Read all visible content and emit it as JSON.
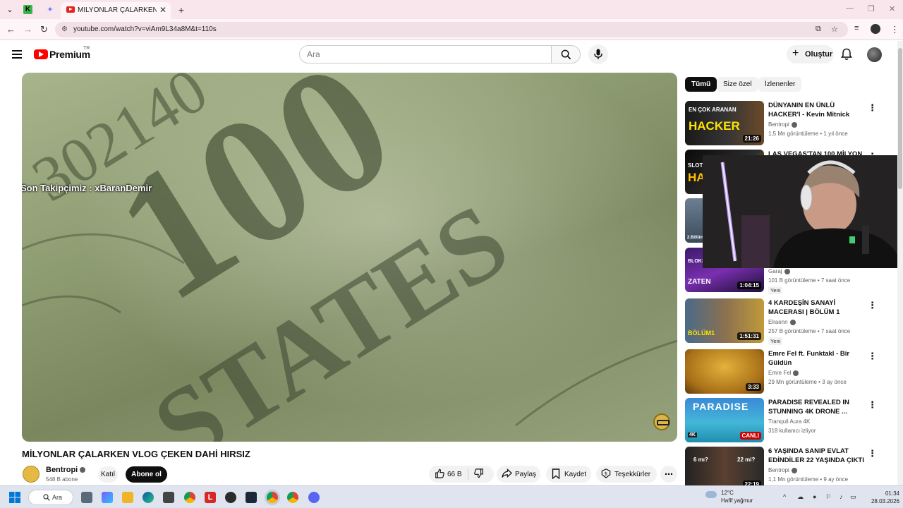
{
  "browser": {
    "tab_title": "MİLYONLAR ÇALARKEN VLOG ÇEKEN DAHİ HIRSIZ",
    "url": "youtube.com/watch?v=viAm9L34a8M&t=110s"
  },
  "masthead": {
    "logo_text": "Premium",
    "country_code": "TR",
    "search_placeholder": "Ara",
    "create_label": "Oluştur"
  },
  "player": {
    "overlay_text": "Son Takipçimiz : xBaranDemir"
  },
  "video": {
    "title": "MİLYONLAR ÇALARKEN VLOG ÇEKEN DAHİ HIRSIZ",
    "channel": "Bentropi",
    "subscribers": "548 B abone",
    "join_label": "Katıl",
    "subscribe_label": "Abone ol",
    "likes": "66 B",
    "share_label": "Paylaş",
    "save_label": "Kaydet",
    "thanks_label": "Teşekkürler"
  },
  "chips": [
    "Tümü",
    "Size özel",
    "İzlenenler"
  ],
  "recommendations": [
    {
      "title": "DÜNYANIN EN ÜNLÜ HACKER'I - Kevin Mitnick",
      "channel": "Bentropi",
      "meta": "1,5 Mn görüntüleme • 1 yıl önce",
      "duration": "21:26",
      "badge": ""
    },
    {
      "title": "LAS VEGAS'TAN 100 MİLYON",
      "channel": "",
      "meta": "",
      "duration": "",
      "badge": ""
    },
    {
      "title": "",
      "channel": "",
      "meta": "",
      "duration": "",
      "badge": ""
    },
    {
      "title": "",
      "channel": "Garaj",
      "meta": "101 B görüntüleme • 7 saat önce",
      "duration": "1:04:15",
      "badge": "Yeni"
    },
    {
      "title": "4 KARDEŞİN SANAYİ MACERASI | BÖLÜM 1",
      "channel": "Elraenn",
      "meta": "257 B görüntüleme • 7 saat önce",
      "duration": "1:51:31",
      "badge": "Yeni"
    },
    {
      "title": "Emre Fel ft. Funktakl - Bir Güldün",
      "channel": "Emre Fel",
      "meta": "29 Mn görüntüleme • 3 ay önce",
      "duration": "3:33",
      "badge": ""
    },
    {
      "title": "PARADISE REVEALED IN STUNNING 4K DRONE ...",
      "channel": "Tranquil Aura 4K",
      "meta": "318 kullanıcı izliyor",
      "duration": "CANLI",
      "badge": ""
    },
    {
      "title": "6 YAŞINDA SANIP EVLAT EDİNDİLER 22 YAŞINDA ÇIKTI",
      "channel": "Bentropi",
      "meta": "1,1 Mn görüntüleme • 9 ay önce",
      "duration": "22:19",
      "badge": ""
    }
  ],
  "thumb_labels": {
    "hacker_top": "EN ÇOK ARANAN",
    "hacker_main": "HACKER",
    "vegas_top": "SLOT",
    "vegas_main": "HA",
    "garaj_top": "BLOK3",
    "garaj_main": "ZATEN",
    "sanayi_main": "BÖLÜM1",
    "paradise_main": "PARADISE",
    "paradise_res": "4K",
    "evlat_left": "6 mı?",
    "evlat_right": "22 mi?",
    "bolum_small": "2.Bölüm"
  },
  "taskbar": {
    "search_label": "Ara",
    "temperature": "12°C",
    "weather": "Hafif yağmur",
    "time": "01:34",
    "date": "28.03.2026"
  },
  "colors": {
    "accent": "#ff0000",
    "tab_bg": "#f9e6ec"
  }
}
